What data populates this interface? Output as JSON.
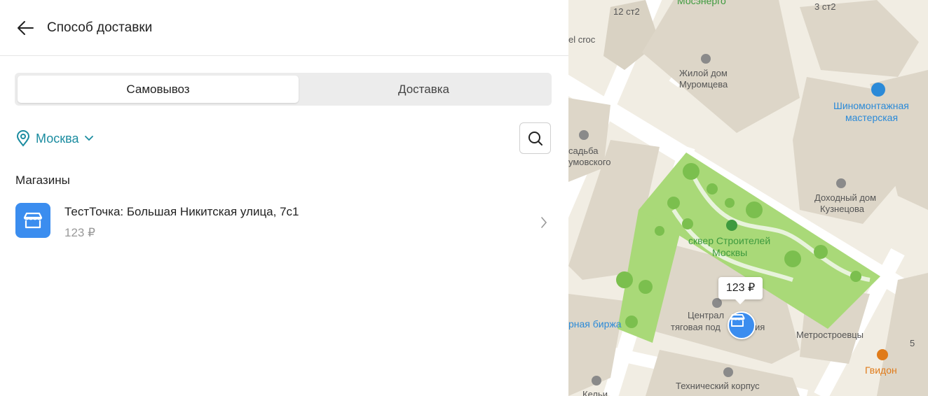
{
  "header": {
    "title": "Способ доставки"
  },
  "tabs": [
    {
      "label": "Самовывоз",
      "active": true
    },
    {
      "label": "Доставка",
      "active": false
    }
  ],
  "city": {
    "name": "Москва"
  },
  "section": {
    "title": "Магазины"
  },
  "stores": [
    {
      "name": "ТестТочка: Большая Никитская улица, 7с1",
      "price": "123 ₽"
    }
  ],
  "map": {
    "price_bubble": "123 ₽",
    "labels": {
      "bldg_12": "12 ст2",
      "mosenergo": "Мосэнерго",
      "bldg_3": "3 ст2",
      "crocs": "el croc",
      "house_muromtsev_1": "Жилой дом",
      "house_muromtsev_2": "Муромцева",
      "tyre_1": "Шиномонтажная",
      "tyre_2": "мастерская",
      "usadba_1": "садьба",
      "usadba_2": "умовского",
      "dokhodny_1": "Доходный дом",
      "dokhodny_2": "Кузнецова",
      "square_1": "сквер Строителей",
      "square_2": "Москвы",
      "substation_1": "Централ",
      "substation_2": "тяговая под",
      "substation_3": "ия",
      "birzha": "рная биржа",
      "metrostroevtsy": "Метростроевцы",
      "gvidon": "Гвидон",
      "bldg_5": "5",
      "tech_corpus": "Технический корпус",
      "kelyi": "Кельи"
    }
  },
  "colors": {
    "accent": "#1b8ca0",
    "store_blue": "#3b8def"
  }
}
